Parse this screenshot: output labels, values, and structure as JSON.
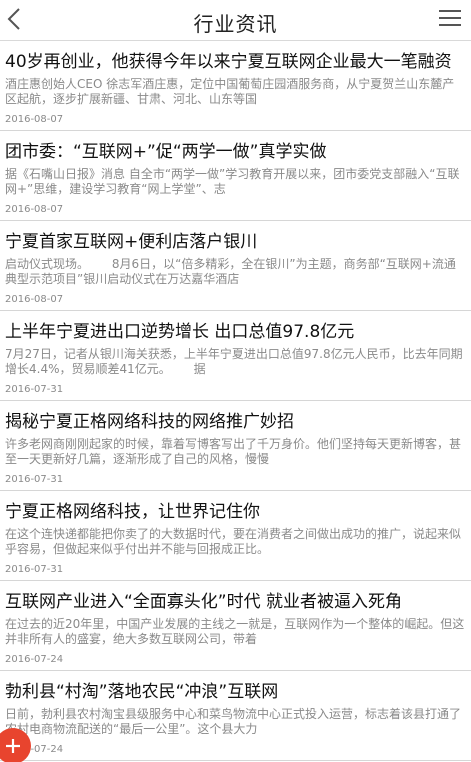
{
  "header": {
    "title": "行业资讯"
  },
  "news": [
    {
      "title": "40岁再创业，他获得今年以来宁夏互联网企业最大一笔融资",
      "summary": "酒庄惠创始人CEO 徐志军酒庄惠，定位中国葡萄庄园酒服务商，从宁夏贺兰山东麓产区起航，逐步扩展新疆、甘肃、河北、山东等国",
      "date": "2016-08-07"
    },
    {
      "title": "团市委：“互联网+”促“两学一做”真学实做",
      "summary": "据《石嘴山日报》消息 自全市“两学一做”学习教育开展以来，团市委党支部融入“互联网+”思维，建设学习教育“网上学堂”、志",
      "date": "2016-08-07"
    },
    {
      "title": "宁夏首家互联网+便利店落户银川",
      "summary": "启动仪式现场。      8月6日，以“倍多精彩，全在银川”为主题，商务部“互联网+流通典型示范项目”银川启动仪式在万达嘉华酒店",
      "date": "2016-08-07"
    },
    {
      "title": "上半年宁夏进出口逆势增长 出口总值97.8亿元",
      "summary": "7月27日，记者从银川海关获悉，上半年宁夏进出口总值97.8亿元人民币，比去年同期增长4.4%，贸易顺差41亿元。      据",
      "date": "2016-07-31"
    },
    {
      "title": "揭秘宁夏正格网络科技的网络推广妙招",
      "summary": "许多老网商刚刚起家的时候，靠着写博客写出了千万身价。他们坚持每天更新博客，甚至一天更新好几篇，逐渐形成了自己的风格，慢慢",
      "date": "2016-07-31"
    },
    {
      "title": "宁夏正格网络科技，让世界记住你",
      "summary": "在这个连快递都能把你卖了的大数据时代，要在消费者之间做出成功的推广，说起来似乎容易，但做起来似乎付出并不能与回报成正比。",
      "date": "2016-07-31"
    },
    {
      "title": "互联网产业进入“全面寡头化”时代 就业者被逼入死角",
      "summary": "在过去的近20年里，中国产业发展的主线之一就是，互联网作为一个整体的崛起。但这并非所有人的盛宴，绝大多数互联网公司，带着",
      "date": "2016-07-24"
    },
    {
      "title": "勃利县“村淘”落地农民“冲浪”互联网",
      "summary": "日前，勃利县农村淘宝县级服务中心和菜鸟物流中心正式投入运营，标志着该县打通了农村电商物流配送的“最后一公里”。这个县大力",
      "date": "2016-07-24"
    }
  ],
  "icons": {
    "back": "chevron-left-icon",
    "menu": "hamburger-menu-icon",
    "fab": "plus-icon"
  },
  "colors": {
    "fab": "#e8442e"
  }
}
